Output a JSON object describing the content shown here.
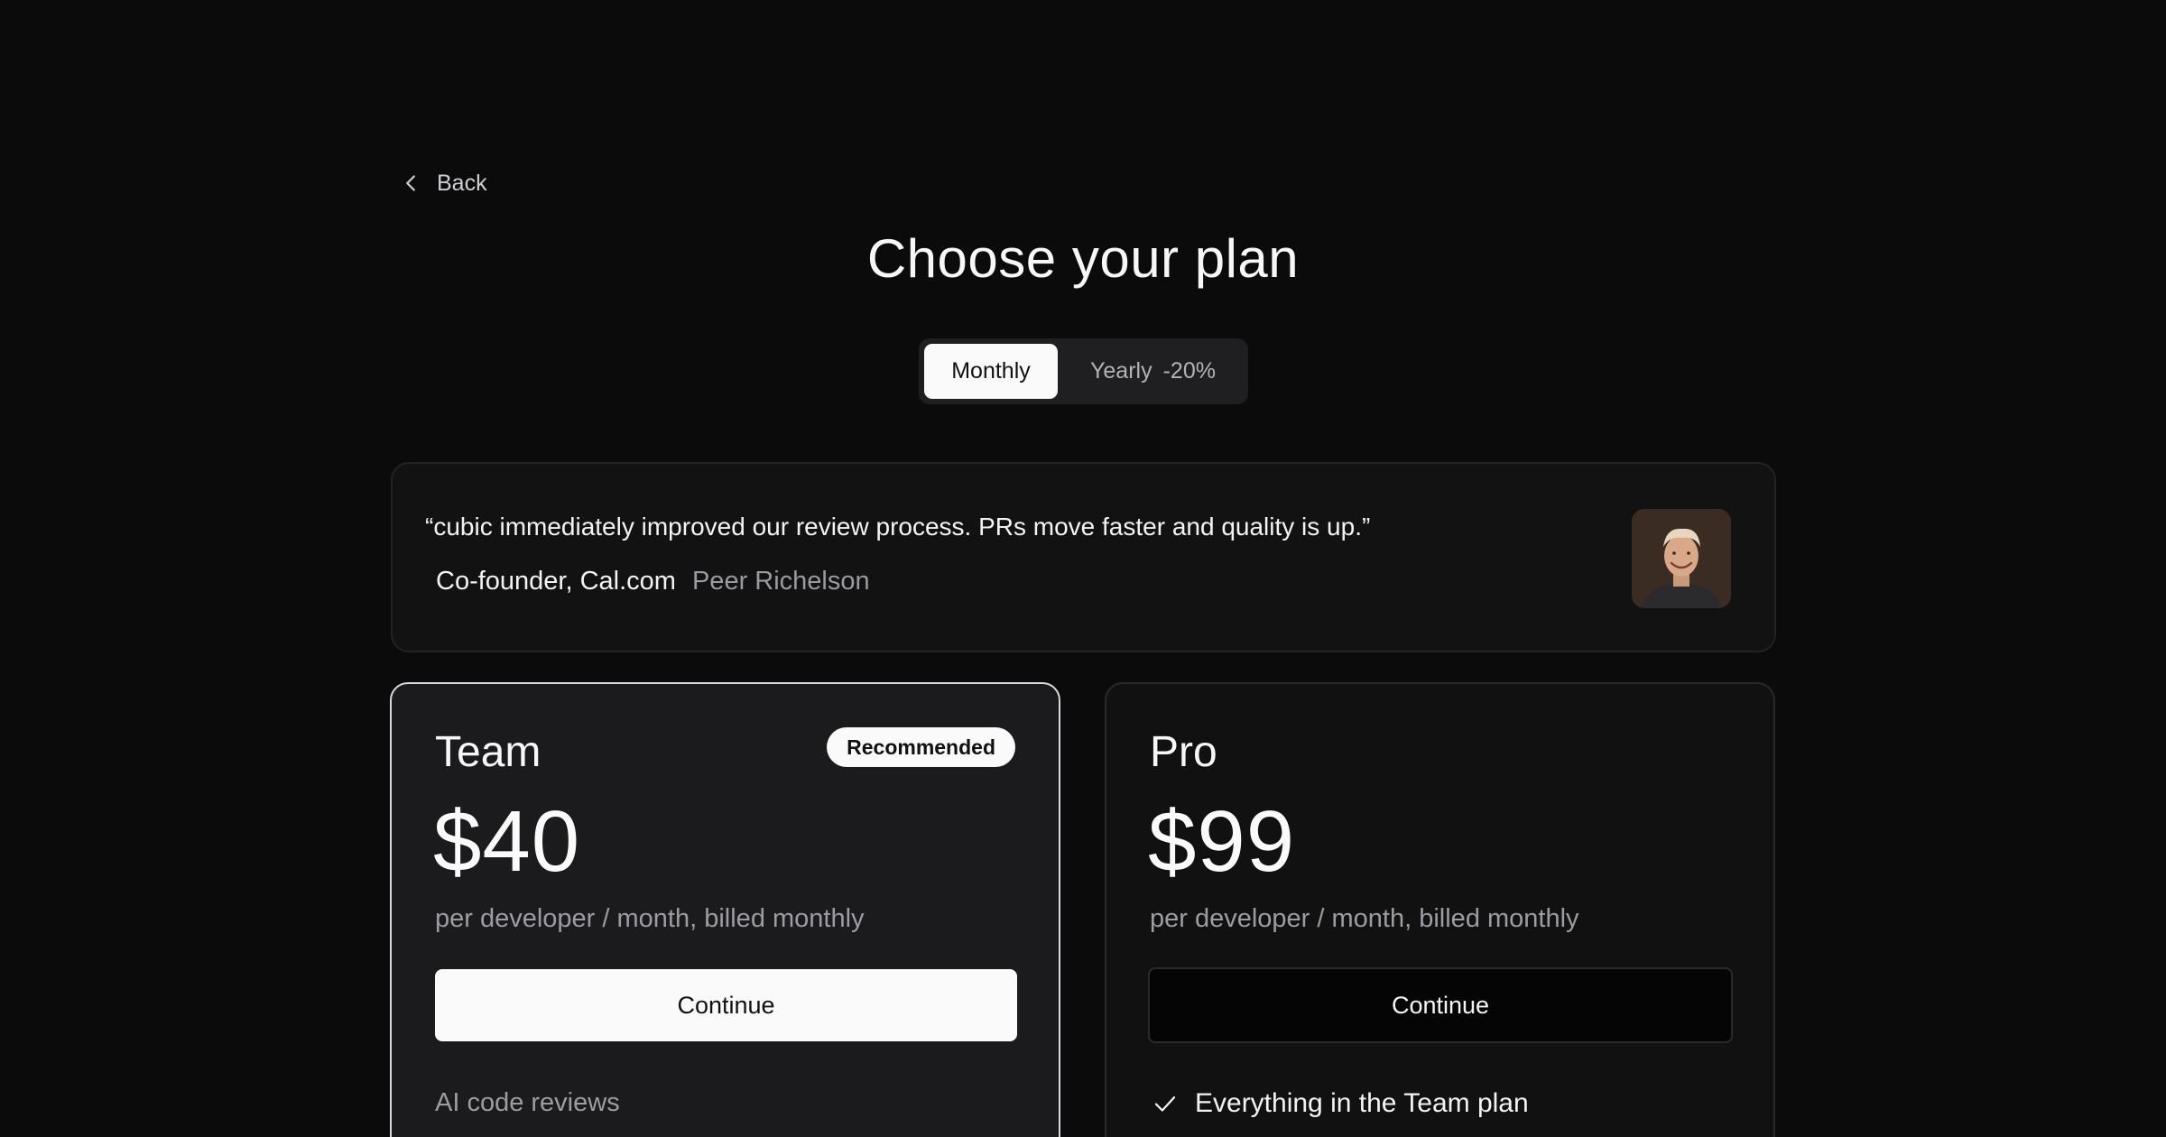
{
  "nav": {
    "back_label": "Back"
  },
  "header": {
    "title": "Choose your plan"
  },
  "billing_toggle": {
    "monthly_label": "Monthly",
    "yearly_label": "Yearly",
    "yearly_discount": "-20%",
    "selected": "Monthly"
  },
  "testimonial": {
    "quote": "“cubic immediately improved our review process. PRs move faster and quality is up.”",
    "role": "Co-founder, Cal.com",
    "person": "Peer Richelson"
  },
  "plans": [
    {
      "name": "Team",
      "badge": "Recommended",
      "price": "$40",
      "billing": "per developer / month, billed monthly",
      "cta": "Continue",
      "feature_heading": "AI code reviews"
    },
    {
      "name": "Pro",
      "price": "$99",
      "billing": "per developer / month, billed monthly",
      "cta": "Continue",
      "feature": "Everything in the Team plan"
    }
  ],
  "colors": {
    "background": "#0b0b0c",
    "card_team_bg": "#1b1b1d",
    "card_pro_bg": "#111112",
    "accent_light": "#fafafa",
    "muted_text": "#9c9ca2"
  },
  "icons": {
    "back": "chevron-left-icon",
    "feature_check": "check-icon"
  }
}
